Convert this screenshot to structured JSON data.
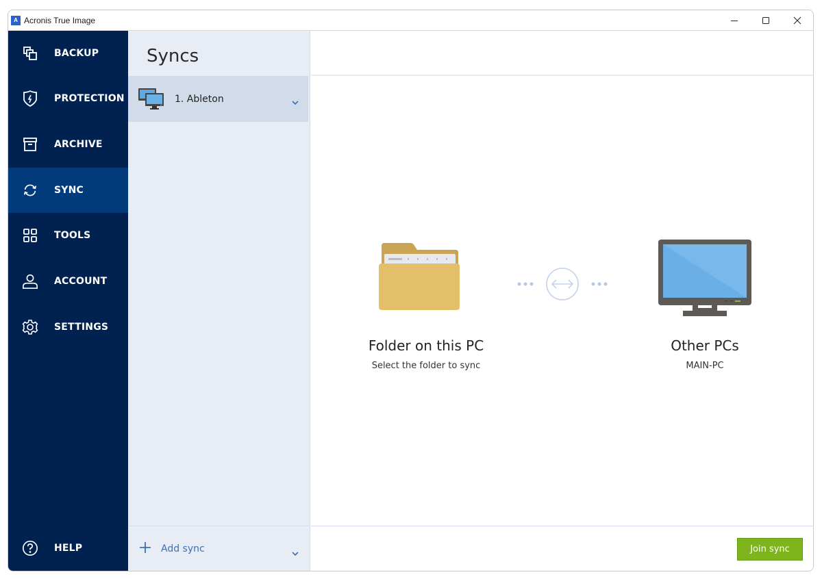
{
  "window": {
    "title": "Acronis True Image",
    "logo_letter": "A",
    "controls": [
      "minimize",
      "maximize",
      "close"
    ]
  },
  "sidebar": {
    "items": [
      {
        "label": "BACKUP",
        "icon": "backup-icon",
        "active": false
      },
      {
        "label": "PROTECTION",
        "icon": "shield-icon",
        "active": false
      },
      {
        "label": "ARCHIVE",
        "icon": "archive-icon",
        "active": false
      },
      {
        "label": "SYNC",
        "icon": "sync-icon",
        "active": true
      },
      {
        "label": "TOOLS",
        "icon": "tools-grid-icon",
        "active": false
      },
      {
        "label": "ACCOUNT",
        "icon": "user-icon",
        "active": false
      },
      {
        "label": "SETTINGS",
        "icon": "gear-icon",
        "active": false
      }
    ],
    "help": {
      "label": "HELP",
      "icon": "help-icon"
    }
  },
  "list": {
    "title": "Syncs",
    "items": [
      {
        "label": "1. Ableton",
        "icon": "computers-icon"
      }
    ],
    "add_label": "Add sync"
  },
  "main": {
    "source": {
      "title": "Folder on this PC",
      "subtitle": "Select the folder to sync"
    },
    "target": {
      "title": "Other PCs",
      "subtitle": "MAIN-PC"
    },
    "join_button": "Join sync"
  },
  "colors": {
    "sidebar_bg": "#012150",
    "sidebar_active": "#013b7c",
    "list_bg": "#e8ecf5",
    "list_selected": "#d1dbea",
    "accent_link": "#3a6fb5",
    "join_button": "#7fb51c"
  }
}
